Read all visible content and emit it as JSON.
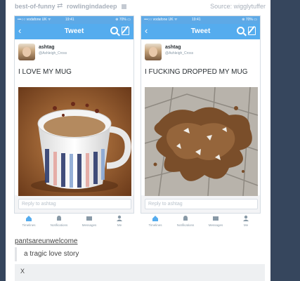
{
  "header": {
    "source_a": "best-of-funny",
    "reblog_glyph": "⇄",
    "source_b": "rowlingindadeep",
    "source_right": "Source: wigglytuffer"
  },
  "phones": [
    {
      "carrier": "•••○○ vodafone UK ᯤ",
      "time": "19:41",
      "battery": "⊛ 70% ▭",
      "nav_back": "‹",
      "nav_title": "Tweet",
      "user_name": "ashtag",
      "user_handle": "@Ashleigh_Cross",
      "tweet_text": "I LOVE MY MUG",
      "reply_placeholder": "Reply to ashtag",
      "tabs": [
        "Timelines",
        "Notifications",
        "Messages",
        "Me"
      ]
    },
    {
      "carrier": "•••○○ vodafone UK ᯤ",
      "time": "19:41",
      "battery": "⊛ 70% ▭",
      "nav_back": "‹",
      "nav_title": "Tweet",
      "user_name": "ashtag",
      "user_handle": "@Ashleigh_Cross",
      "tweet_text": "I FUCKING DROPPED MY MUG",
      "reply_placeholder": "Reply to ashtag",
      "tabs": [
        "Timelines",
        "Notifications",
        "Messages",
        "Me"
      ]
    }
  ],
  "comment": {
    "user": "pantsareunwelcome",
    "text": "a tragic love story"
  },
  "footer": {
    "text": "X"
  },
  "colors": {
    "twitter_blue": "#55acee",
    "dashboard_rail": "#36465d"
  }
}
